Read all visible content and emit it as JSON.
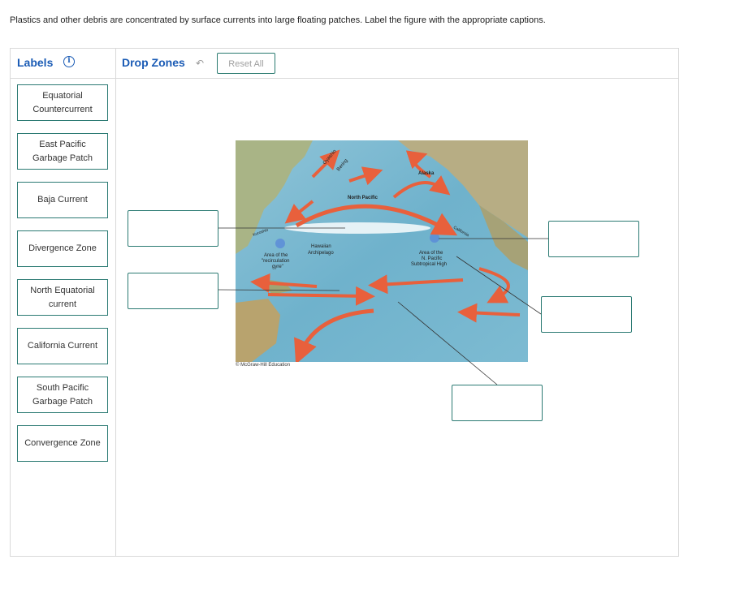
{
  "prompt": "Plastics and other debris are concentrated by surface currents into large floating patches. Label the figure with the appropriate captions.",
  "labels_panel": {
    "title": "Labels",
    "items": [
      "Equatorial Countercurrent",
      "East Pacific Garbage Patch",
      "Baja Current",
      "Divergence Zone",
      "North Equatorial current",
      "California Current",
      "South Pacific Garbage Patch",
      "Convergence Zone"
    ]
  },
  "drop_zones": {
    "title": "Drop Zones",
    "reset_label": "Reset All"
  },
  "map": {
    "labels": {
      "oyashio": "Oyashio",
      "bering": "Bering",
      "alaska": "Alaska",
      "north_pacific": "North Pacific",
      "kuroshio": "Kuroshio",
      "california": "California",
      "hawaiian": "Hawaiian",
      "archipelago": "Archipelago",
      "area_recirc_1": "Area of the",
      "area_recirc_2": "\"recirculation",
      "area_recirc_3": "gyre\"",
      "area_high_1": "Area of the",
      "area_high_2": "N. Pacific",
      "area_high_3": "Subtropical High"
    },
    "credit": "© McGraw-Hill Education"
  },
  "colors": {
    "accent": "#1a5bb5",
    "border": "#2b7a73",
    "arrow": "#e8603c"
  }
}
